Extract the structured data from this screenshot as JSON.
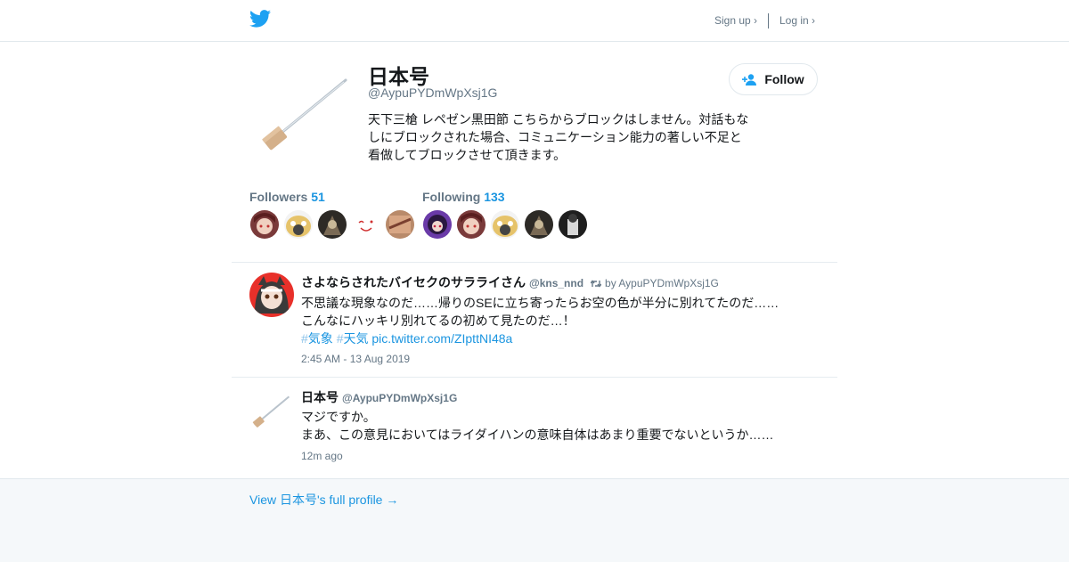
{
  "nav": {
    "signup": "Sign up ›",
    "login": "Log in ›"
  },
  "colors": {
    "brand": "#1da1f2",
    "link": "#1b95e0",
    "text": "#14171a",
    "muted": "#657786"
  },
  "profile": {
    "name": "日本号",
    "handle": "@AypuPYDmWpXsj1G",
    "bio": "天下三槍 レペゼン黒田節 こちらからブロックはしません。対話もなしにブロックされた場合、コミュニケーション能力の著しい不足と看做してブロックさせて頂きます。",
    "follow_label": "Follow"
  },
  "stats": {
    "followers_label": "Followers",
    "followers_count": "51",
    "following_label": "Following",
    "following_count": "133"
  },
  "tweets": [
    {
      "name": "さよならされたバイセクのサラライさん",
      "handle": "@kns_nnd",
      "retweeted_by": "by AypuPYDmWpXsj1G",
      "line1": "不思議な現象なのだ……帰りのSEに立ち寄ったらお空の色が半分に別れてたのだ……",
      "line2": "こんなにハッキリ別れてるの初めて見たのだ…！",
      "hashtag1": "気象",
      "hashtag2": "天気",
      "pic_link": "pic.twitter.com/ZIpttNI48a",
      "time": "2:45 AM - 13 Aug 2019"
    },
    {
      "name": "日本号",
      "handle": "@AypuPYDmWpXsj1G",
      "line1": "マジですか。",
      "line2": "まあ、この意見においてはライダイハンの意味自体はあまり重要でないというか……",
      "time": "12m ago"
    }
  ],
  "footer": {
    "link": "View 日本号's full profile →"
  }
}
